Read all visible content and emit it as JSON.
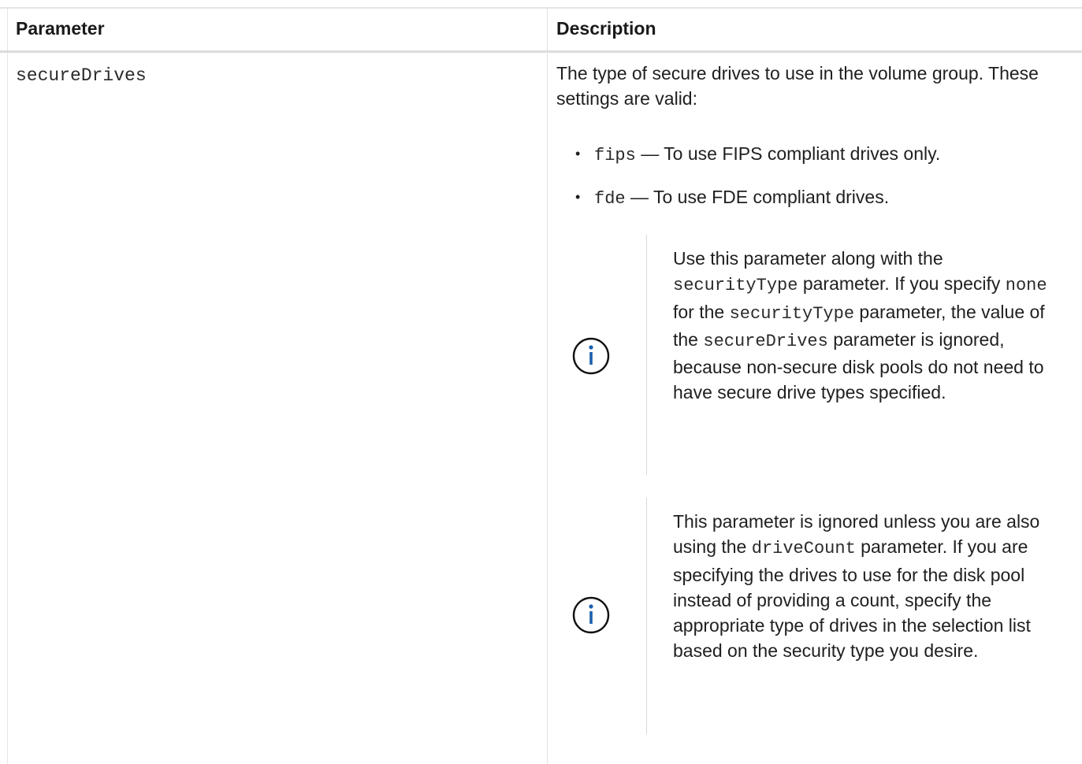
{
  "table": {
    "headers": {
      "parameter": "Parameter",
      "description": "Description"
    },
    "row": {
      "parameter": "secureDrives",
      "intro": "The type of secure drives to use in the volume group. These settings are valid:",
      "options": [
        {
          "code": "fips",
          "text": " — To use FIPS compliant drives only."
        },
        {
          "code": "fde",
          "text": " — To use FDE compliant drives."
        }
      ],
      "notes": [
        {
          "icon": "info-icon",
          "parts": {
            "a": "Use this parameter along with the ",
            "b": "securityType",
            "c": " parameter. If you specify ",
            "d": "none",
            "e": " for the ",
            "f": "securityType",
            "g": " parameter, the value of the ",
            "h": "secureDrives",
            "i": " parameter is ignored, because non-secure disk pools do not need to have secure drive types specified."
          }
        },
        {
          "icon": "info-icon",
          "parts": {
            "a": "This parameter is ignored unless you are also using the ",
            "b": "driveCount",
            "c": " parameter. If you are specifying the drives to use for the disk pool instead of providing a count, specify the appropriate type of drives in the selection list based on the security type you desire."
          }
        }
      ]
    }
  },
  "colors": {
    "icon": "#1b5fad"
  }
}
